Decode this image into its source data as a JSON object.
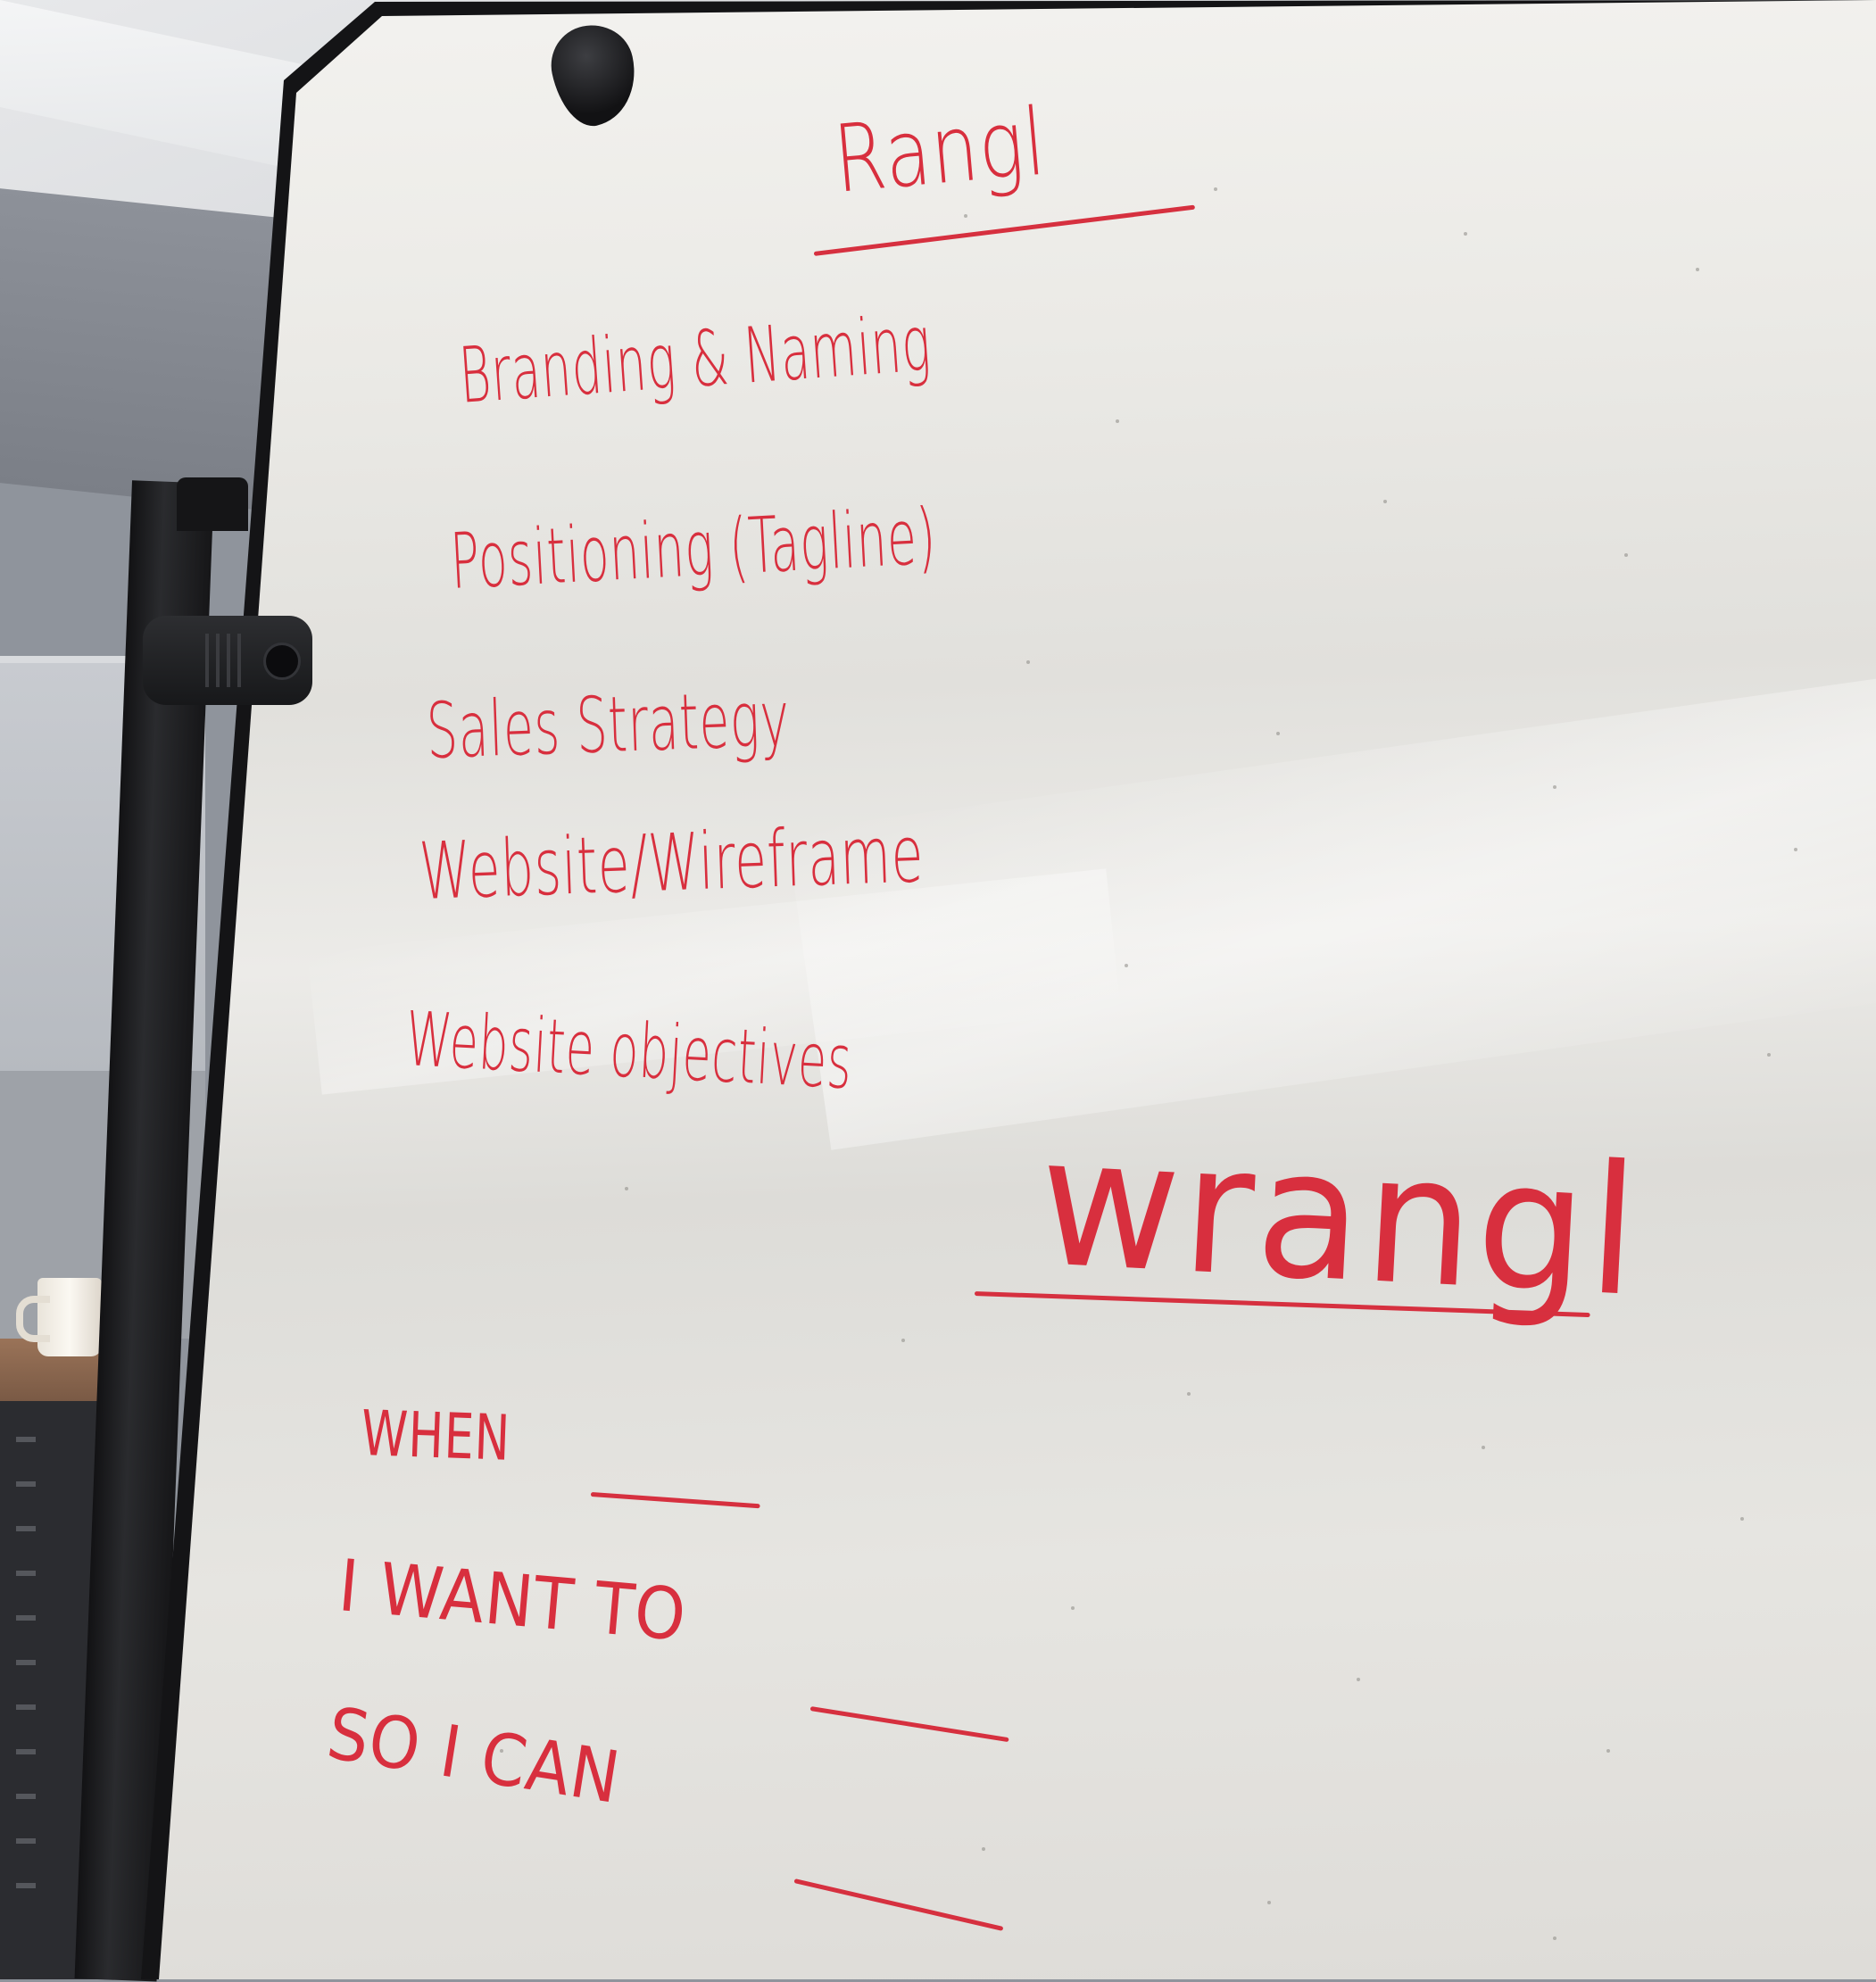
{
  "whiteboard": {
    "title": "Rangl",
    "items": [
      "Branding & Naming",
      "Positioning (Tagline)",
      "Sales Strategy",
      "Website/Wireframe",
      "Website objectives"
    ],
    "emphasis_word": "wrangl",
    "prompts": [
      "WHEN",
      "I WANT TO",
      "SO I CAN"
    ]
  },
  "colors": {
    "marker_ink": "#d82f3e",
    "board": "#e8e7e3",
    "frame": "#141416"
  }
}
